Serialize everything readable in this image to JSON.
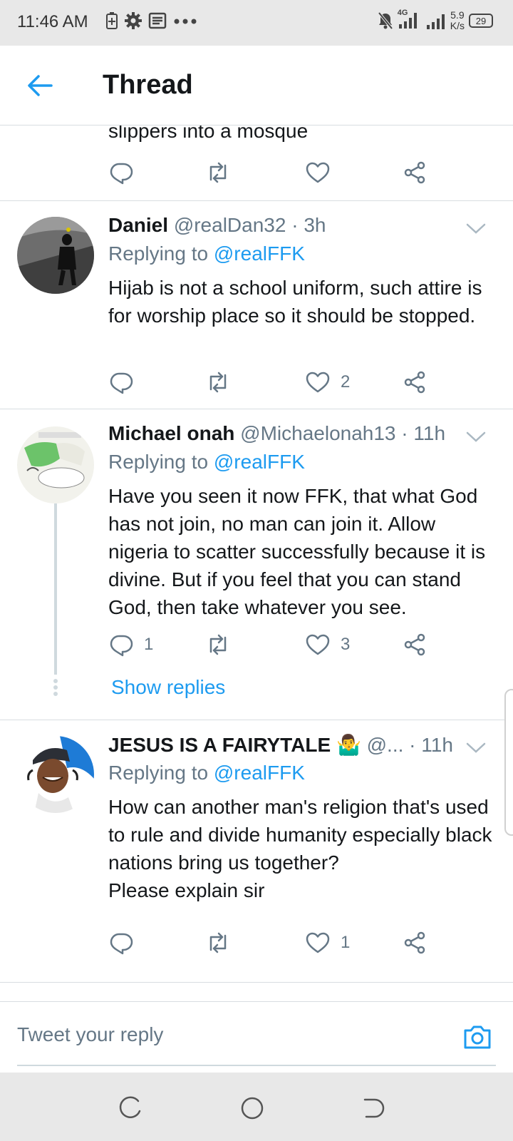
{
  "status_bar": {
    "time": "11:46 AM",
    "network": "4G",
    "speed_value": "5.9",
    "speed_unit": "K/s",
    "battery": "29"
  },
  "header": {
    "title": "Thread"
  },
  "tweets": [
    {
      "body": "slippers into a mosque",
      "likes": "",
      "replies": ""
    },
    {
      "name": "Daniel",
      "handle": "@realDan32",
      "time": "· 3h",
      "replying_label": "Replying to",
      "replying_to": "@realFFK",
      "body": "Hijab is not a school uniform, such attire is for worship place so it should be stopped.",
      "replies": "",
      "likes": "2"
    },
    {
      "name": "Michael onah",
      "handle": "@Michaelonah13",
      "time": "· 11h",
      "replying_label": "Replying to",
      "replying_to": "@realFFK",
      "body": "Have you seen it now FFK, that what God has not join, no man can join it. Allow nigeria to scatter successfully because it is divine. But if you feel that you can stand God, then take whatever you see.",
      "replies": "1",
      "likes": "3",
      "show_replies": "Show replies"
    },
    {
      "name": "JESUS IS A FAIRYTALE 🤷‍♂️",
      "handle": "@...",
      "time": "· 11h",
      "replying_label": "Replying to",
      "replying_to": "@realFFK",
      "body_lines": [
        "How can another man's religion that's used to rule and divide humanity especially black nations bring us together?",
        "Please explain sir"
      ],
      "replies": "",
      "likes": "1"
    }
  ],
  "reply_bar": {
    "placeholder": "Tweet your reply"
  },
  "colors": {
    "accent": "#1d9bf0",
    "muted": "#657786",
    "divider": "#d8dde1"
  },
  "icons": [
    "reply-icon",
    "retweet-icon",
    "like-icon",
    "share-icon",
    "back-arrow-icon",
    "chevron-down-icon",
    "camera-icon"
  ]
}
